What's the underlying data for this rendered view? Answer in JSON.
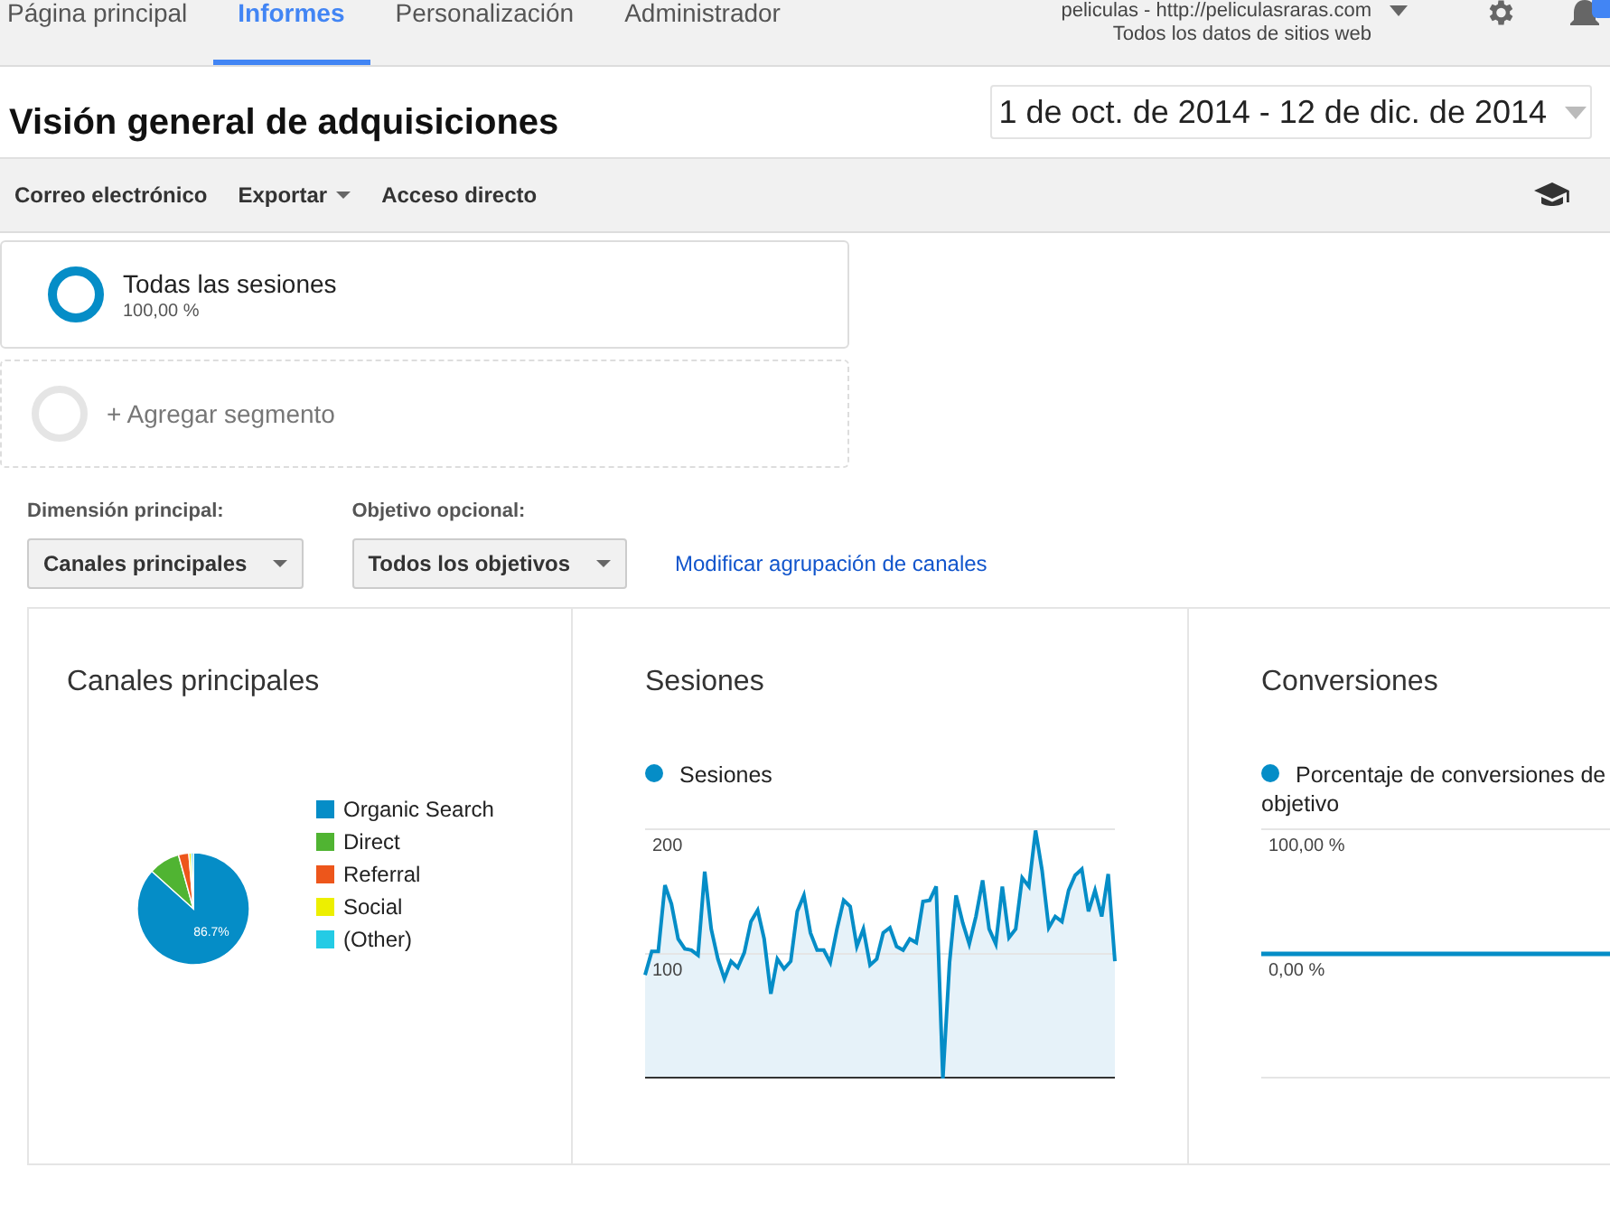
{
  "nav": {
    "tabs": [
      {
        "label": "Página principal",
        "selected": false
      },
      {
        "label": "Informes",
        "selected": true
      },
      {
        "label": "Personalización",
        "selected": false
      },
      {
        "label": "Administrador",
        "selected": false
      }
    ],
    "account": {
      "property": "peliculas - http://peliculasraras.com",
      "view": "Todos los datos de sitios web"
    }
  },
  "report": {
    "title": "Visión general de adquisiciones",
    "date_range": "1 de oct. de 2014 - 12 de dic. de 2014"
  },
  "toolbar": [
    {
      "label": "Correo electrónico",
      "kind": "plain"
    },
    {
      "label": "Exportar",
      "kind": "menu"
    },
    {
      "label": "Acceso directo",
      "kind": "plain"
    }
  ],
  "segments": [
    {
      "kind": "active",
      "name": "Todas las sesiones",
      "share": "100,00 %"
    },
    {
      "kind": "add",
      "name": "+ Agregar segmento"
    }
  ],
  "controls": {
    "dimension": {
      "label": "Dimensión principal:",
      "value": "Canales principales"
    },
    "goal": {
      "label": "Objetivo opcional:",
      "value": "Todos los objetivos"
    },
    "link": "Modificar agrupación de canales"
  },
  "panels": [
    {
      "kind": "pie",
      "title": "Canales principales",
      "slice_label": "86.7%",
      "legend": [
        {
          "label": "Organic Search",
          "color": "#058dc7"
        },
        {
          "label": "Direct",
          "color": "#50b432"
        },
        {
          "label": "Referral",
          "color": "#ed561b"
        },
        {
          "label": "Social",
          "color": "#edef00"
        },
        {
          "label": "(Other)",
          "color": "#24cbe5"
        }
      ]
    },
    {
      "kind": "line",
      "title": "Sesiones",
      "chart_data": {
        "type": "area",
        "ylim": [
          0,
          200
        ],
        "yticks": [
          100,
          200
        ],
        "series": [
          {
            "name": "Sesiones",
            "color": "#058dc7",
            "values": [
              83,
              102,
              102,
              155,
              140,
              112,
              104,
              103,
              99,
              166,
              120,
              96,
              80,
              94,
              89,
              101,
              126,
              135,
              112,
              68,
              96,
              88,
              94,
              134,
              147,
              117,
              103,
              103,
              93,
              120,
              143,
              138,
              106,
              120,
              91,
              96,
              117,
              121,
              106,
              103,
              112,
              109,
              142,
              143,
              154,
              0,
              93,
              147,
              125,
              108,
              130,
              159,
              120,
              108,
              154,
              113,
              120,
              161,
              154,
              199,
              167,
              121,
              130,
              126,
              151,
              163,
              168,
              134,
              151,
              130,
              164,
              94
            ]
          }
        ]
      }
    },
    {
      "kind": "line",
      "title": "Conversiones",
      "chart_data": {
        "type": "line",
        "ylim": [
          -100,
          100
        ],
        "yticks": [
          {
            "value": 0,
            "label": "0,00 %"
          },
          {
            "value": 100,
            "label": "100,00 %"
          }
        ],
        "series": [
          {
            "name": "Porcentaje de conversiones de objetivo",
            "color": "#058dc7",
            "values": [
              0,
              0,
              0,
              0,
              0,
              0,
              0,
              0,
              0,
              0,
              0,
              0,
              0,
              0,
              0,
              0,
              0,
              0,
              0,
              0
            ]
          }
        ]
      }
    }
  ]
}
